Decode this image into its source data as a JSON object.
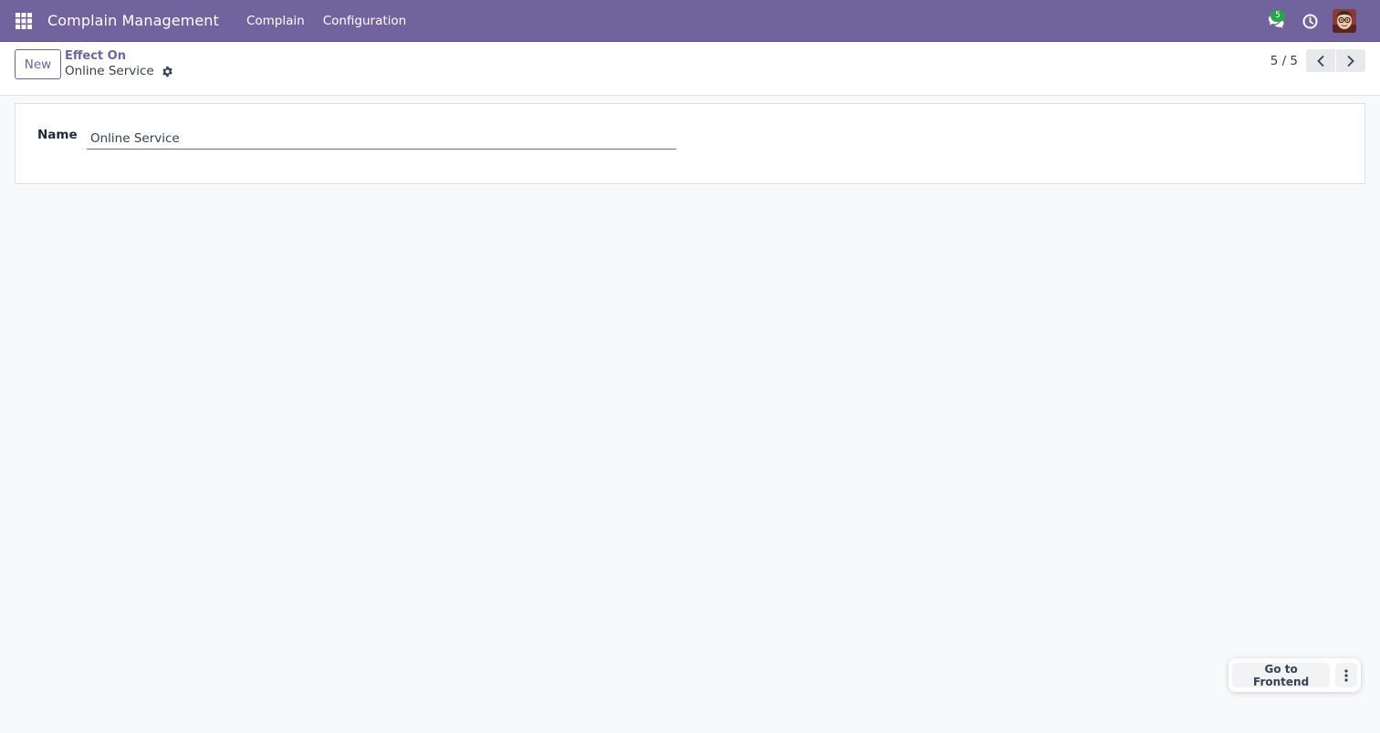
{
  "navbar": {
    "brand": "Complain Management",
    "menu": [
      "Complain",
      "Configuration"
    ],
    "messages_count": "5"
  },
  "control_panel": {
    "new_label": "New",
    "breadcrumb_parent": "Effect On",
    "breadcrumb_current": "Online Service",
    "pager": "5 / 5"
  },
  "form": {
    "name_label": "Name",
    "name_value": "Online Service"
  },
  "widget": {
    "frontend_label": "Go to Frontend"
  },
  "colors": {
    "brand": "#71639e",
    "badge": "#28a745",
    "background": "#f8f9fa"
  },
  "icons": [
    "apps-grid-icon",
    "chat-icon",
    "clock-icon",
    "gear-icon",
    "chevron-left-icon",
    "chevron-right-icon",
    "kebab-icon"
  ]
}
